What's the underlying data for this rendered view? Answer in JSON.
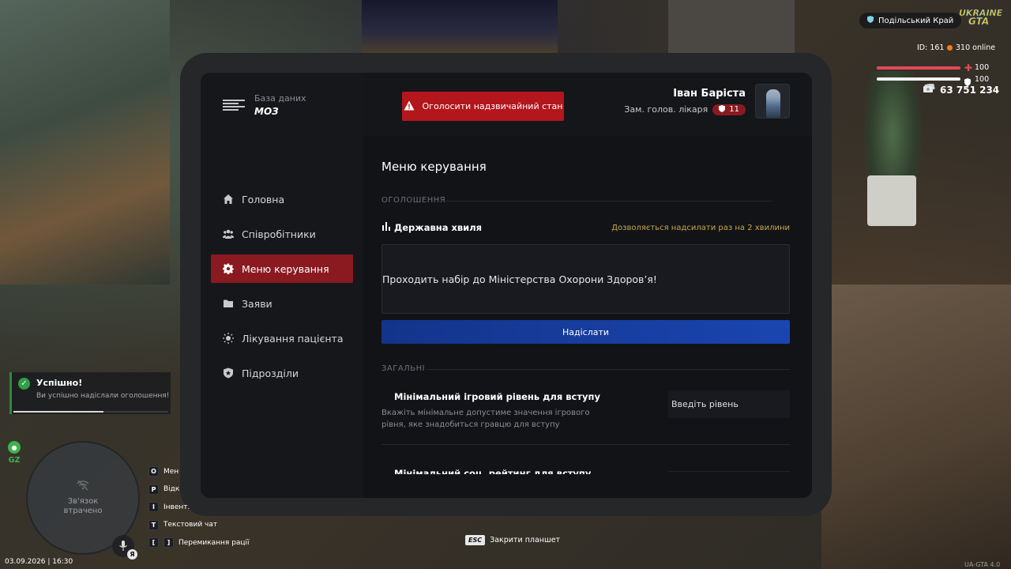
{
  "app": {
    "brand_subtitle": "База даних",
    "brand_title": "МОЗ",
    "alert_button": "Оголосити надзвичайний стан",
    "user": {
      "name": "Іван Барiста",
      "role": "Зам. голов. лікаря",
      "rank": "11"
    }
  },
  "sidebar": {
    "items": [
      {
        "label": "Головна",
        "icon": "home-icon",
        "active": false
      },
      {
        "label": "Співробітники",
        "icon": "users-icon",
        "active": false
      },
      {
        "label": "Меню керування",
        "icon": "gear-icon",
        "active": true
      },
      {
        "label": "Заяви",
        "icon": "folder-icon",
        "active": false
      },
      {
        "label": "Лікування пацієнта",
        "icon": "sun-icon",
        "active": false
      },
      {
        "label": "Підрозділи",
        "icon": "shield-icon",
        "active": false
      }
    ]
  },
  "main": {
    "title": "Меню керування",
    "section_announcements": "ОГОЛОШЕННЯ",
    "wave_title": "Державна хвиля",
    "wave_note": "Дозволяється надсилати раз на 2 хвилини",
    "wave_text": "Проходить набір до Міністерства Охорони Здоров’я!",
    "send_button": "Надіслати",
    "section_general": "ЗАГАЛЬНІ",
    "setting_min_level": {
      "title": "Мінімальний ігровий рівень для вступу",
      "description": "Вкажіть мінімальне допустиме значення ігрового рівня, яке знадобиться гравцю для вступу",
      "placeholder": "Введіть рівень"
    },
    "setting_next_title": "Мінімальний соц. рейтинг для вступу"
  },
  "hud": {
    "region": "Подільський Край",
    "logo_top": "UKRAINE",
    "logo_bottom": "GTA",
    "id": "ID: 161",
    "online": "310 online",
    "health": "100",
    "armor": "100",
    "money": "63 751 234",
    "health_fraction": 1.0,
    "armor_fraction": 1.0
  },
  "notification": {
    "title": "Успішно!",
    "text": "Ви успішно надіслали оголошення!",
    "progress": 0.58
  },
  "minimap": {
    "zone_label": "GZ",
    "status": "Зв'язок втрачено",
    "mic_badge": "Я",
    "datetime": "03.09.2026 | 16:30"
  },
  "hotkeys": [
    {
      "keys": [
        "O"
      ],
      "label": "Меню"
    },
    {
      "keys": [
        "P"
      ],
      "label": "Відкрити"
    },
    {
      "keys": [
        "I"
      ],
      "label": "Інвент."
    },
    {
      "keys": [
        "T"
      ],
      "label": "Текстовий чат"
    },
    {
      "keys": [
        "[",
        "]"
      ],
      "label": "Перемикання рації"
    }
  ],
  "esc_hint": {
    "key": "ESC",
    "label": "Закрити планшет"
  },
  "watermark": "UA-GTA 4.0",
  "colors": {
    "accent_red": "#b3161c",
    "active_nav": "#8a1a20",
    "send_blue": "#1a45b0",
    "note_gold": "#c9a64a",
    "health_red": "#e24a57",
    "success_green": "#2f9e44"
  }
}
